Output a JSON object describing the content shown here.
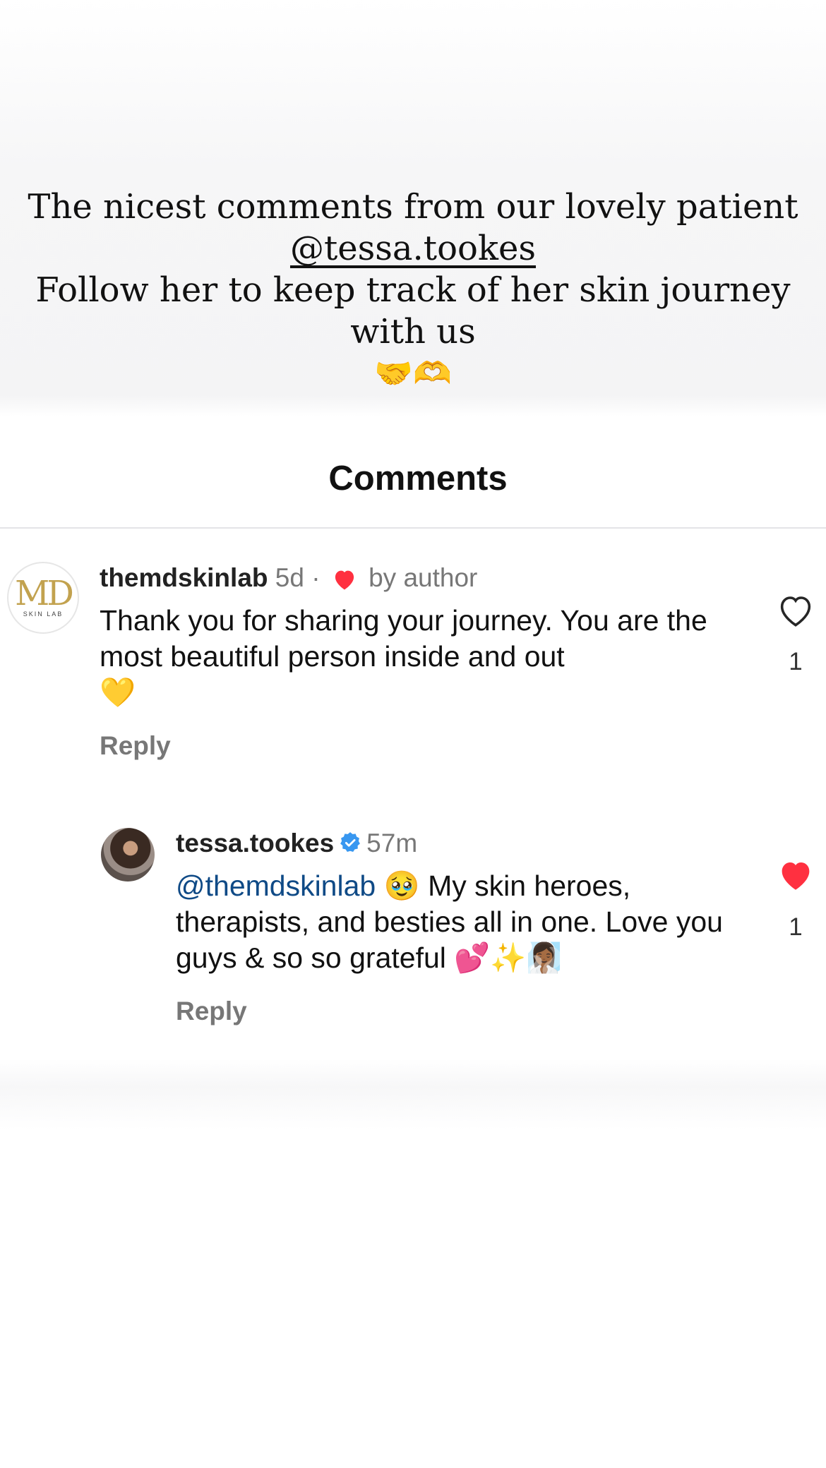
{
  "story": {
    "line1": "The nicest comments from our lovely patient",
    "mention": "@tessa.tookes",
    "line3": "Follow her to keep track of her skin journey with us",
    "emojis": "🤝🫶"
  },
  "sheet": {
    "title": "Comments"
  },
  "comments": [
    {
      "avatar": {
        "logo_text": "MD",
        "logo_sub": "SKIN LAB"
      },
      "username": "themdskinlab",
      "time": "5d",
      "separator": "·",
      "liked_by_author_label": "by author",
      "text": "Thank you for sharing your journey. You are the most beautiful person inside and out",
      "text_emoji": "💛",
      "reply_label": "Reply",
      "like_count": "1",
      "liked": false
    },
    {
      "username": "tessa.tookes",
      "verified": true,
      "time": "57m",
      "mention": "@themdskinlab",
      "mention_emoji": "🥹",
      "text": "My skin heroes, therapists, and besties all in one. Love you guys & so so grateful",
      "text_emojis": "💕✨🧖🏾‍♀️",
      "reply_label": "Reply",
      "like_count": "1",
      "liked": true
    }
  ],
  "colors": {
    "like_red": "#ff3040",
    "mention_blue": "#0f4a86",
    "verified_blue": "#3897f0",
    "logo_gold": "#c2a24f"
  }
}
